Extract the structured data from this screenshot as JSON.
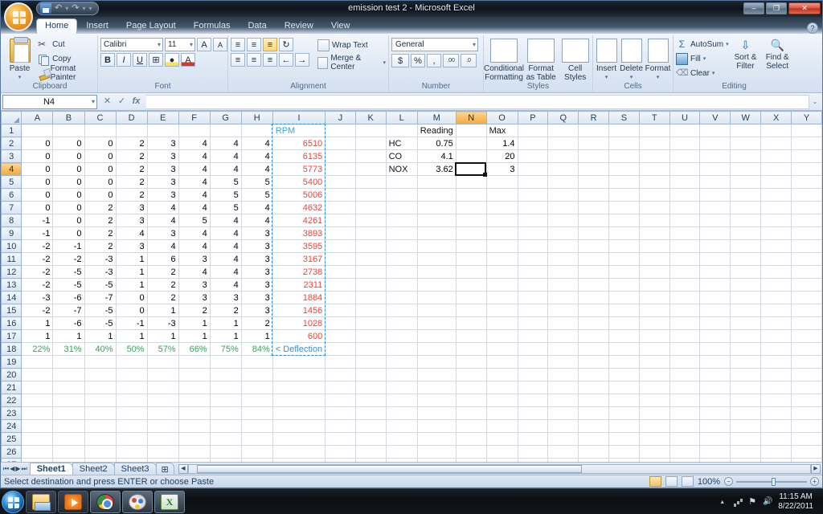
{
  "window": {
    "title": "emission test 2 - Microsoft Excel",
    "minimize_label": "–",
    "maximize_label": "❐",
    "close_label": "✕"
  },
  "quick_access": {
    "save_label": "Save",
    "undo_label": "Undo",
    "redo_label": "Redo",
    "customize_label": "▾"
  },
  "office_button": {
    "label": "Office Button"
  },
  "ribbon": {
    "tabs": [
      {
        "label": "Home",
        "active": true
      },
      {
        "label": "Insert",
        "active": false
      },
      {
        "label": "Page Layout",
        "active": false
      },
      {
        "label": "Formulas",
        "active": false
      },
      {
        "label": "Data",
        "active": false
      },
      {
        "label": "Review",
        "active": false
      },
      {
        "label": "View",
        "active": false
      }
    ],
    "help_icon": "?",
    "groups": {
      "clipboard": {
        "label": "Clipboard",
        "paste": "Paste",
        "cut": "Cut",
        "copy": "Copy",
        "format_painter": "Format Painter",
        "dialog_launcher": "↘"
      },
      "font": {
        "label": "Font",
        "font_name": "Calibri",
        "font_size": "11",
        "grow_font": "A",
        "shrink_font": "A",
        "bold": "B",
        "italic": "I",
        "underline": "U",
        "borders": "⊞",
        "fill_color": "A",
        "font_color": "A",
        "dialog_launcher": "↘"
      },
      "alignment": {
        "label": "Alignment",
        "align_top": "≡",
        "align_middle": "≡",
        "align_bottom": "≡",
        "orientation": "↻",
        "align_left": "≡",
        "align_center": "≡",
        "align_right": "≡",
        "decrease_indent": "←",
        "increase_indent": "→",
        "wrap_text": "Wrap Text",
        "merge_center": "Merge & Center",
        "dialog_launcher": "↘"
      },
      "number": {
        "label": "Number",
        "format": "General",
        "accounting": "$",
        "percent": "%",
        "comma": ",",
        "increase_decimal": ".00",
        "decrease_decimal": ".0",
        "dialog_launcher": "↘"
      },
      "styles": {
        "label": "Styles",
        "conditional_formatting": "Conditional Formatting",
        "format_as_table": "Format as Table",
        "cell_styles": "Cell Styles"
      },
      "cells": {
        "label": "Cells",
        "insert": "Insert",
        "delete": "Delete",
        "format": "Format"
      },
      "editing": {
        "label": "Editing",
        "autosum": "AutoSum",
        "fill": "Fill",
        "clear": "Clear",
        "sort_filter": "Sort & Filter",
        "find_select": "Find & Select"
      }
    }
  },
  "formula_bar": {
    "name_box_value": "N4",
    "name_box_dropdown": "▾",
    "cancel": "✕",
    "enter": "✓",
    "insert_function": "fx",
    "formula_value": "",
    "expand": "⌄"
  },
  "grid": {
    "columns": [
      "A",
      "B",
      "C",
      "D",
      "E",
      "F",
      "G",
      "H",
      "I",
      "J",
      "K",
      "L",
      "M",
      "N",
      "O",
      "P",
      "Q",
      "R",
      "S",
      "T",
      "U",
      "V",
      "W",
      "X",
      "Y"
    ],
    "selected_column": "N",
    "selected_row": 4,
    "selected_cell": "N4",
    "rows": [
      {
        "n": 1,
        "cells": {
          "I": "RPM"
        }
      },
      {
        "n": 2,
        "cells": {
          "A": "0",
          "B": "0",
          "C": "0",
          "D": "2",
          "E": "3",
          "F": "4",
          "G": "4",
          "H": "4",
          "I": "6510"
        }
      },
      {
        "n": 3,
        "cells": {
          "A": "0",
          "B": "0",
          "C": "0",
          "D": "2",
          "E": "3",
          "F": "4",
          "G": "4",
          "H": "4",
          "I": "6135"
        }
      },
      {
        "n": 4,
        "cells": {
          "A": "0",
          "B": "0",
          "C": "0",
          "D": "2",
          "E": "3",
          "F": "4",
          "G": "4",
          "H": "4",
          "I": "5773"
        }
      },
      {
        "n": 5,
        "cells": {
          "A": "0",
          "B": "0",
          "C": "0",
          "D": "2",
          "E": "3",
          "F": "4",
          "G": "5",
          "H": "5",
          "I": "5400"
        }
      },
      {
        "n": 6,
        "cells": {
          "A": "0",
          "B": "0",
          "C": "0",
          "D": "2",
          "E": "3",
          "F": "4",
          "G": "5",
          "H": "5",
          "I": "5006"
        }
      },
      {
        "n": 7,
        "cells": {
          "A": "0",
          "B": "0",
          "C": "2",
          "D": "3",
          "E": "4",
          "F": "4",
          "G": "5",
          "H": "4",
          "I": "4632"
        }
      },
      {
        "n": 8,
        "cells": {
          "A": "-1",
          "B": "0",
          "C": "2",
          "D": "3",
          "E": "4",
          "F": "5",
          "G": "4",
          "H": "4",
          "I": "4261"
        }
      },
      {
        "n": 9,
        "cells": {
          "A": "-1",
          "B": "0",
          "C": "2",
          "D": "4",
          "E": "3",
          "F": "4",
          "G": "4",
          "H": "3",
          "I": "3893"
        }
      },
      {
        "n": 10,
        "cells": {
          "A": "-2",
          "B": "-1",
          "C": "2",
          "D": "3",
          "E": "4",
          "F": "4",
          "G": "4",
          "H": "3",
          "I": "3595"
        }
      },
      {
        "n": 11,
        "cells": {
          "A": "-2",
          "B": "-2",
          "C": "-3",
          "D": "1",
          "E": "6",
          "F": "3",
          "G": "4",
          "H": "3",
          "I": "3167"
        }
      },
      {
        "n": 12,
        "cells": {
          "A": "-2",
          "B": "-5",
          "C": "-3",
          "D": "1",
          "E": "2",
          "F": "4",
          "G": "4",
          "H": "3",
          "I": "2738"
        }
      },
      {
        "n": 13,
        "cells": {
          "A": "-2",
          "B": "-5",
          "C": "-5",
          "D": "1",
          "E": "2",
          "F": "3",
          "G": "4",
          "H": "3",
          "I": "2311"
        }
      },
      {
        "n": 14,
        "cells": {
          "A": "-3",
          "B": "-6",
          "C": "-7",
          "D": "0",
          "E": "2",
          "F": "3",
          "G": "3",
          "H": "3",
          "I": "1884"
        }
      },
      {
        "n": 15,
        "cells": {
          "A": "-2",
          "B": "-7",
          "C": "-5",
          "D": "0",
          "E": "1",
          "F": "2",
          "G": "2",
          "H": "3",
          "I": "1456"
        }
      },
      {
        "n": 16,
        "cells": {
          "A": "1",
          "B": "-6",
          "C": "-5",
          "D": "-1",
          "E": "-3",
          "F": "1",
          "G": "1",
          "H": "2",
          "I": "1028"
        }
      },
      {
        "n": 17,
        "cells": {
          "A": "1",
          "B": "1",
          "C": "1",
          "D": "1",
          "E": "1",
          "F": "1",
          "G": "1",
          "H": "1",
          "I": "600"
        }
      },
      {
        "n": 18,
        "cells": {
          "A": "22%",
          "B": "31%",
          "C": "40%",
          "D": "50%",
          "E": "57%",
          "F": "66%",
          "G": "75%",
          "H": "84%",
          "I": "< Deflection"
        }
      },
      {
        "n": 19,
        "cells": {}
      },
      {
        "n": 20,
        "cells": {}
      },
      {
        "n": 21,
        "cells": {}
      },
      {
        "n": 22,
        "cells": {}
      },
      {
        "n": 23,
        "cells": {}
      },
      {
        "n": 24,
        "cells": {}
      },
      {
        "n": 25,
        "cells": {}
      },
      {
        "n": 26,
        "cells": {}
      },
      {
        "n": 27,
        "cells": {}
      }
    ],
    "right_table": {
      "header_reading": "Reading",
      "header_max": "Max",
      "rows": [
        {
          "label": "HC",
          "reading": "0.75",
          "max": "1.4"
        },
        {
          "label": "CO",
          "reading": "4.1",
          "max": "20"
        },
        {
          "label": "NOX",
          "reading": "3.62",
          "max": "3"
        }
      ]
    },
    "colors": {
      "rpm_values": "#ff3b30",
      "rpm_header": "#2fa8e0",
      "percent_row": "#32a852",
      "deflection_label": "#3a8fd0",
      "selection_highlight": "#f2a93b"
    }
  },
  "sheet_tabs": {
    "first_label": "⏮",
    "prev_label": "◀",
    "next_label": "▶",
    "last_label": "⏭",
    "tabs": [
      {
        "label": "Sheet1",
        "active": true
      },
      {
        "label": "Sheet2",
        "active": false
      },
      {
        "label": "Sheet3",
        "active": false
      }
    ],
    "new_sheet_label": "➕"
  },
  "scrollbar": {
    "left_arrow": "◀",
    "right_arrow": "▶",
    "grip": "⋯"
  },
  "status_bar": {
    "message": "Select destination and press ENTER or choose Paste",
    "view_normal": "Normal",
    "view_page_layout": "Page Layout",
    "view_page_break": "Page Break Preview",
    "zoom_level": "100%",
    "zoom_out": "−",
    "zoom_in": "+"
  },
  "taskbar": {
    "start_label": "Start",
    "items": [
      {
        "name": "windows-explorer",
        "label": "Windows Explorer",
        "pinned": true,
        "active": false
      },
      {
        "name": "windows-media-player",
        "label": "Windows Media Player",
        "pinned": true,
        "active": false
      },
      {
        "name": "google-chrome",
        "label": "Google Chrome",
        "pinned": true,
        "active": true
      },
      {
        "name": "paint",
        "label": "Paint",
        "pinned": true,
        "active": true
      },
      {
        "name": "microsoft-excel",
        "label": "Microsoft Excel",
        "pinned": true,
        "active": true
      }
    ],
    "tray": {
      "show_hidden": "▲",
      "network": "Network",
      "volume": "Volume",
      "action_center": "Action Center"
    },
    "clock": {
      "time": "11:15 AM",
      "date": "8/22/2011"
    }
  }
}
